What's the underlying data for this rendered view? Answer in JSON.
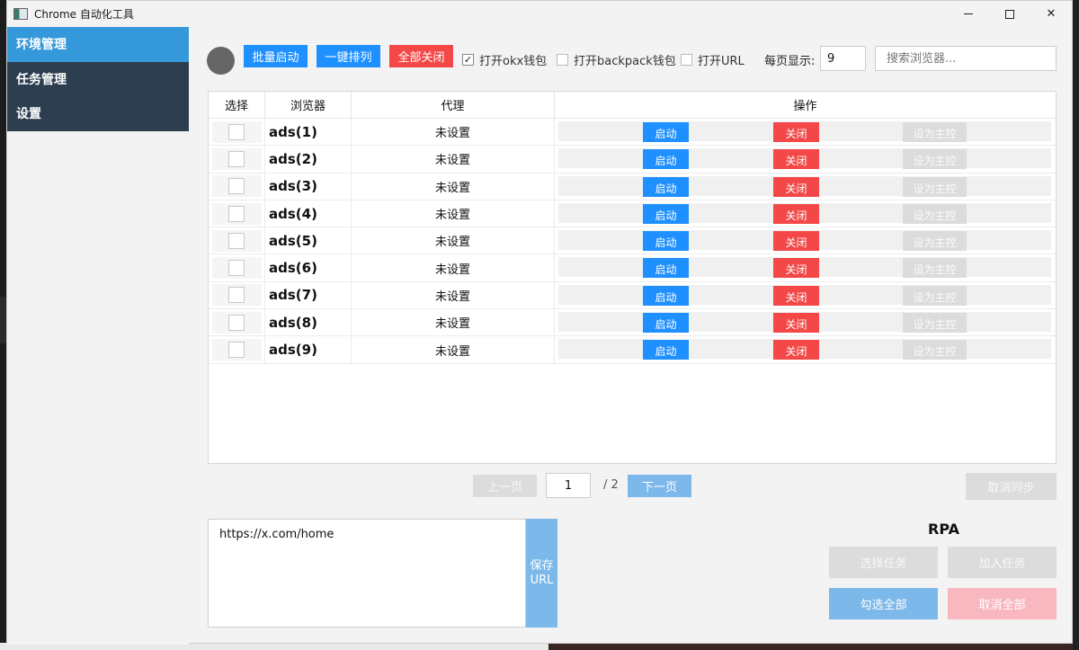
{
  "window": {
    "title": "Chrome 自动化工具"
  },
  "sidebar": {
    "items": [
      {
        "label": "环境管理",
        "active": true
      },
      {
        "label": "任务管理",
        "active": false
      },
      {
        "label": "设置",
        "active": false
      }
    ]
  },
  "toolbar": {
    "batch_start": "批量启动",
    "arrange": "一键排列",
    "close_all": "全部关闭",
    "open_okx": {
      "label": "打开okx钱包",
      "checked": true
    },
    "open_backpack": {
      "label": "打开backpack钱包",
      "checked": false
    },
    "open_url": {
      "label": "打开URL",
      "checked": false
    },
    "per_page_label": "每页显示:",
    "per_page_value": "9",
    "search_placeholder": "搜索浏览器..."
  },
  "table": {
    "headers": {
      "select": "选择",
      "browser": "浏览器",
      "proxy": "代理",
      "actions": "操作"
    },
    "rows": [
      {
        "name": "ads(1)",
        "proxy": "未设置"
      },
      {
        "name": "ads(2)",
        "proxy": "未设置"
      },
      {
        "name": "ads(3)",
        "proxy": "未设置"
      },
      {
        "name": "ads(4)",
        "proxy": "未设置"
      },
      {
        "name": "ads(5)",
        "proxy": "未设置"
      },
      {
        "name": "ads(6)",
        "proxy": "未设置"
      },
      {
        "name": "ads(7)",
        "proxy": "未设置"
      },
      {
        "name": "ads(8)",
        "proxy": "未设置"
      },
      {
        "name": "ads(9)",
        "proxy": "未设置"
      }
    ],
    "action_labels": {
      "start": "启动",
      "close": "关闭",
      "set_master": "设为主控"
    }
  },
  "pager": {
    "prev": "上一页",
    "current": "1",
    "total": "/ 2",
    "next": "下一页",
    "cancel_sync": "取消同步"
  },
  "url_panel": {
    "url": "https://x.com/home",
    "save_label": "保存URL"
  },
  "rpa": {
    "title": "RPA",
    "select_task": "选择任务",
    "add_task": "加入任务",
    "check_all": "勾选全部",
    "uncheck_all": "取消全部"
  },
  "colors": {
    "sidebar_dark": "#2c3e50",
    "sidebar_active": "#3498db",
    "primary": "#1e90ff",
    "danger": "#f44747",
    "primary_light": "#7db8ea",
    "disabled": "#dcdcdc"
  }
}
